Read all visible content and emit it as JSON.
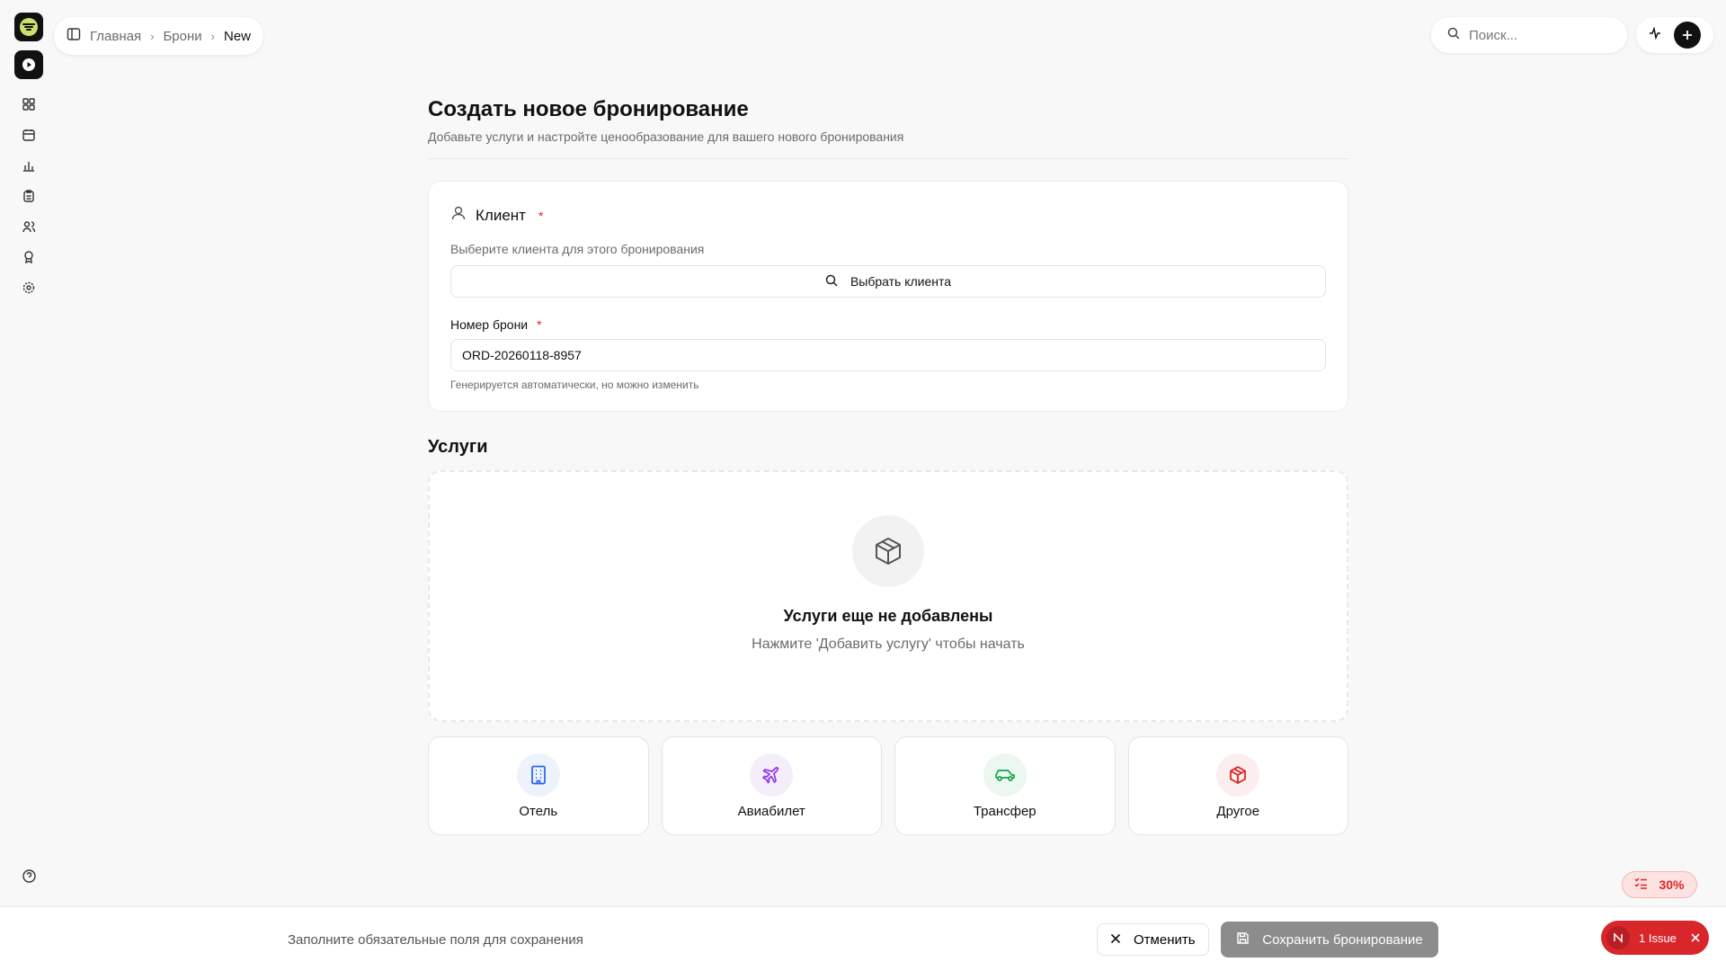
{
  "breadcrumb": {
    "home": "Главная",
    "bookings": "Брони",
    "current": "New"
  },
  "search": {
    "placeholder": "Поиск..."
  },
  "rail": {
    "icons": [
      "logo-icon",
      "play-icon",
      "dashboard-icon",
      "calendar-icon",
      "chart-icon",
      "clipboard-icon",
      "users-icon",
      "award-icon",
      "settings-icon",
      "help-icon"
    ]
  },
  "page": {
    "title": "Создать новое бронирование",
    "subtitle": "Добавьте услуги и настройте ценообразование для вашего нового бронирования"
  },
  "client_card": {
    "title": "Клиент",
    "required_mark": "*",
    "hint": "Выберите клиента для этого бронирования",
    "select_label": "Выбрать клиента",
    "number_label": "Номер брони",
    "number_value": "ORD-20260118-8957",
    "number_hint": "Генерируется автоматически, но можно изменить"
  },
  "services": {
    "title": "Услуги",
    "empty_title": "Услуги еще не добавлены",
    "empty_sub": "Нажмите 'Добавить услугу' чтобы начать",
    "options": [
      {
        "label": "Отель",
        "icon": "building-icon",
        "color": "#2563eb",
        "bg": "#eef2fb"
      },
      {
        "label": "Авиабилет",
        "icon": "plane-icon",
        "color": "#9333ea",
        "bg": "#f4eefb"
      },
      {
        "label": "Трансфер",
        "icon": "car-icon",
        "color": "#16a34a",
        "bg": "#ecf7ef"
      },
      {
        "label": "Другое",
        "icon": "box-icon",
        "color": "#dc2626",
        "bg": "#fbeeee"
      }
    ]
  },
  "footer": {
    "message": "Заполните обязательные поля для сохранения",
    "cancel": "Отменить",
    "save": "Сохранить бронирование"
  },
  "progress": {
    "label": "30%",
    "value": 0.3
  },
  "issues": {
    "label": "1 Issue"
  },
  "colors": {
    "accent": "#111111",
    "required": "#dc2626",
    "save_disabled": "#8c8c8c",
    "issue": "#d9262b"
  }
}
